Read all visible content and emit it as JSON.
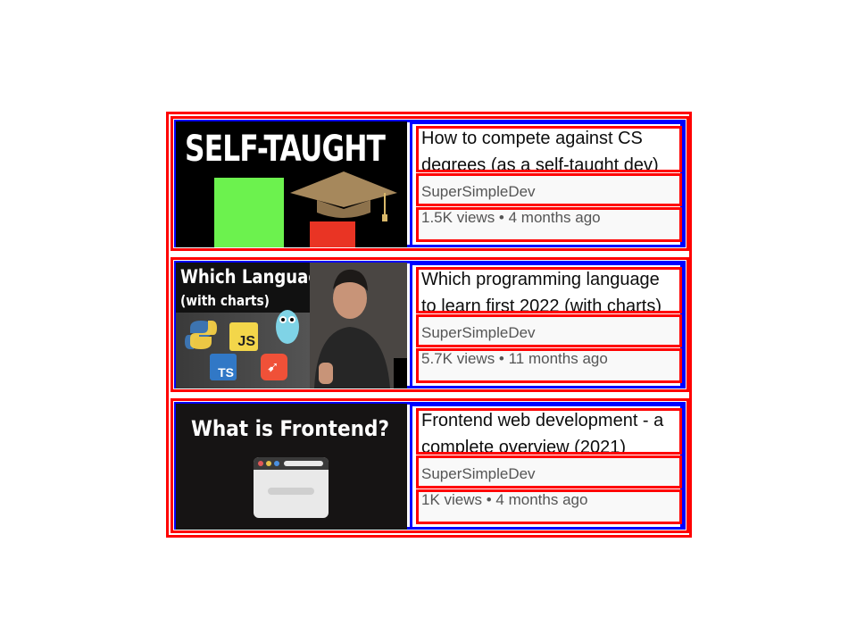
{
  "videos": [
    {
      "thumbnail_text": "SELF-TAUGHT",
      "title_line1": "How to compete against CS",
      "title_line2": "degrees (as a self-taught dev)",
      "author": "SuperSimpleDev",
      "stats": "1.5K views • 4 months ago"
    },
    {
      "thumbnail_text": "Which Language?",
      "thumbnail_subtext": "(with charts)",
      "badge_js": "JS",
      "badge_ts": "TS",
      "title_line1": "Which programming language",
      "title_line2": "to learn first 2022 (with charts)",
      "author": "SuperSimpleDev",
      "stats": "5.7K views • 11 months ago"
    },
    {
      "thumbnail_text": "What is Frontend?",
      "title_line1": "Frontend web development - a",
      "title_line2": "complete overview (2021)",
      "author": "SuperSimpleDev",
      "stats": "1K views • 4 months ago"
    }
  ]
}
